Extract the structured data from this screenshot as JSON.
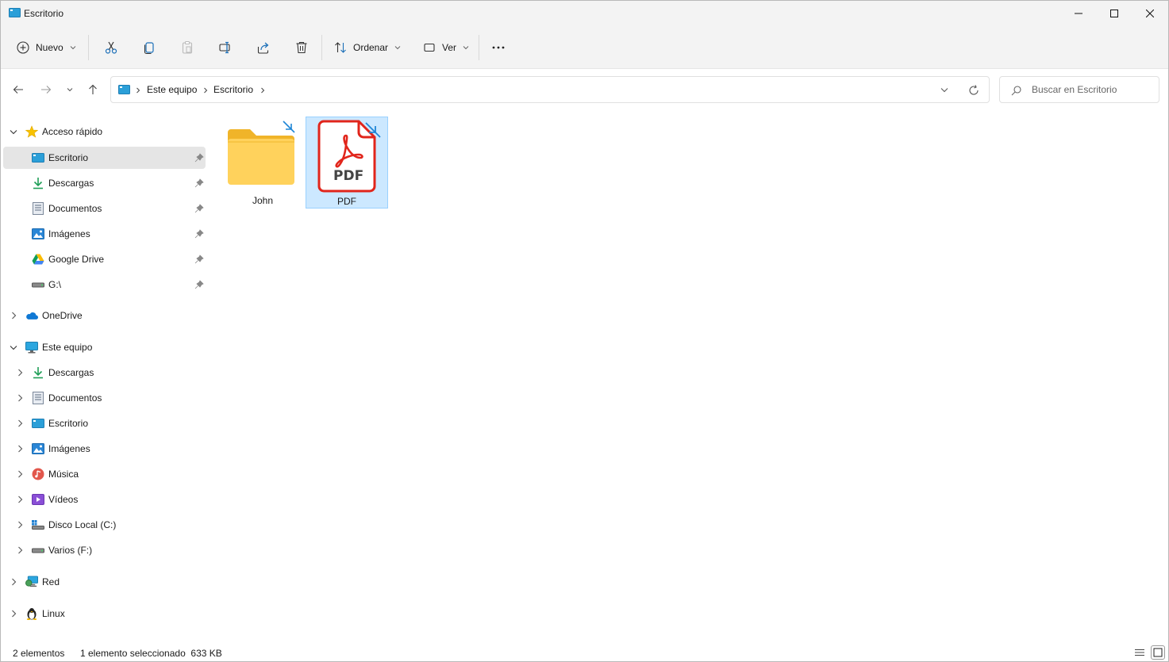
{
  "window": {
    "title": "Escritorio"
  },
  "toolbar": {
    "new_label": "Nuevo",
    "sort_label": "Ordenar",
    "view_label": "Ver"
  },
  "address": {
    "crumbs": [
      "Este equipo",
      "Escritorio"
    ],
    "search_placeholder": "Buscar en Escritorio"
  },
  "sidebar": {
    "quick_access": {
      "label": "Acceso rápido",
      "items": [
        {
          "label": "Escritorio",
          "icon": "desktop-icon",
          "pinned": true,
          "selected": true
        },
        {
          "label": "Descargas",
          "icon": "download-icon",
          "pinned": true
        },
        {
          "label": "Documentos",
          "icon": "documents-icon",
          "pinned": true
        },
        {
          "label": "Imágenes",
          "icon": "pictures-icon",
          "pinned": true
        },
        {
          "label": "Google Drive",
          "icon": "google-drive-icon",
          "pinned": true
        },
        {
          "label": "G:\\",
          "icon": "drive-icon",
          "pinned": true
        }
      ]
    },
    "onedrive": {
      "label": "OneDrive"
    },
    "this_pc": {
      "label": "Este equipo",
      "items": [
        {
          "label": "Descargas",
          "icon": "download-icon"
        },
        {
          "label": "Documentos",
          "icon": "documents-icon"
        },
        {
          "label": "Escritorio",
          "icon": "desktop-icon"
        },
        {
          "label": "Imágenes",
          "icon": "pictures-icon"
        },
        {
          "label": "Música",
          "icon": "music-icon"
        },
        {
          "label": "Vídeos",
          "icon": "videos-icon"
        },
        {
          "label": "Disco Local (C:)",
          "icon": "local-disk-icon"
        },
        {
          "label": "Varios (F:)",
          "icon": "drive-icon"
        }
      ]
    },
    "network": {
      "label": "Red"
    },
    "linux": {
      "label": "Linux"
    }
  },
  "files": [
    {
      "name": "John",
      "type": "folder-shortcut"
    },
    {
      "name": "PDF",
      "type": "pdf-shortcut",
      "selected": true
    }
  ],
  "pdf_badge": "PDF",
  "status": {
    "count": "2 elementos",
    "selection": "1 elemento seleccionado  633 KB"
  },
  "colors": {
    "accent": "#0067c0",
    "selection_bg": "#cce8ff",
    "selection_border": "#99d1ff",
    "folder": "#ffc83d",
    "pdf_red": "#e1251b"
  }
}
